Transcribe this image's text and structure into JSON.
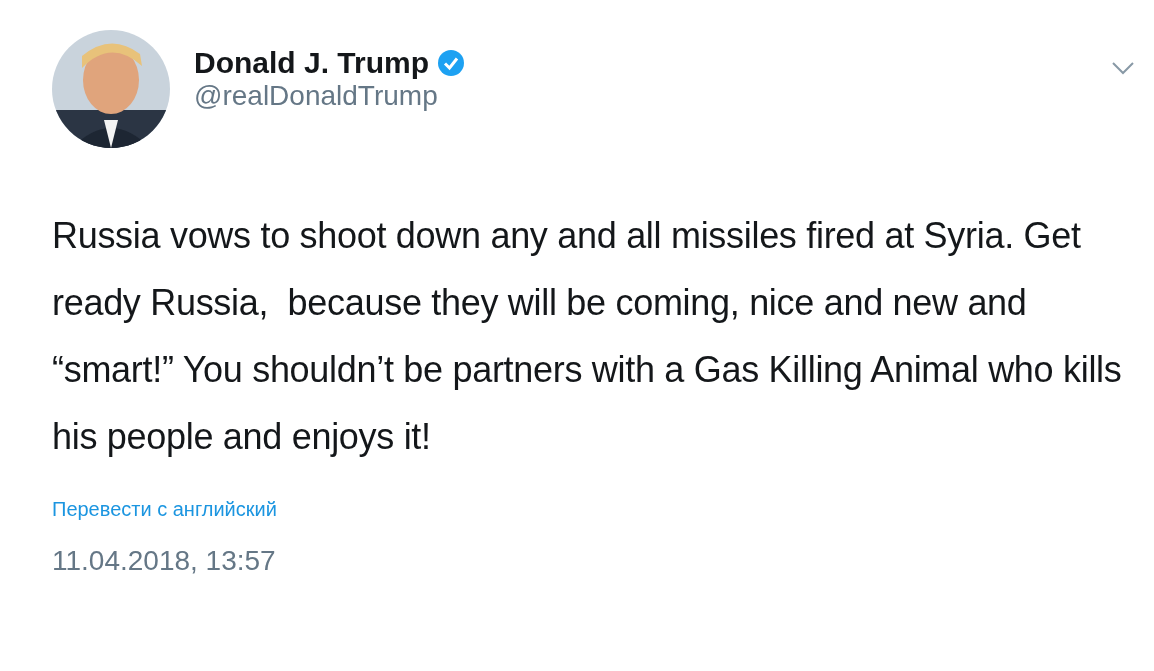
{
  "author": {
    "name": "Donald J. Trump",
    "verified": true,
    "handle": "@realDonaldTrump"
  },
  "tweet": {
    "text": "Russia vows to shoot down any and all missiles fired at Syria. Get ready Russia,  because they will be coming, nice and new and “smart!” You shouldn’t be partners with a Gas Killing Animal who kills his people and enjoys it!"
  },
  "translate_link": "Перевести с английский",
  "timestamp": "11.04.2018, 13:57"
}
